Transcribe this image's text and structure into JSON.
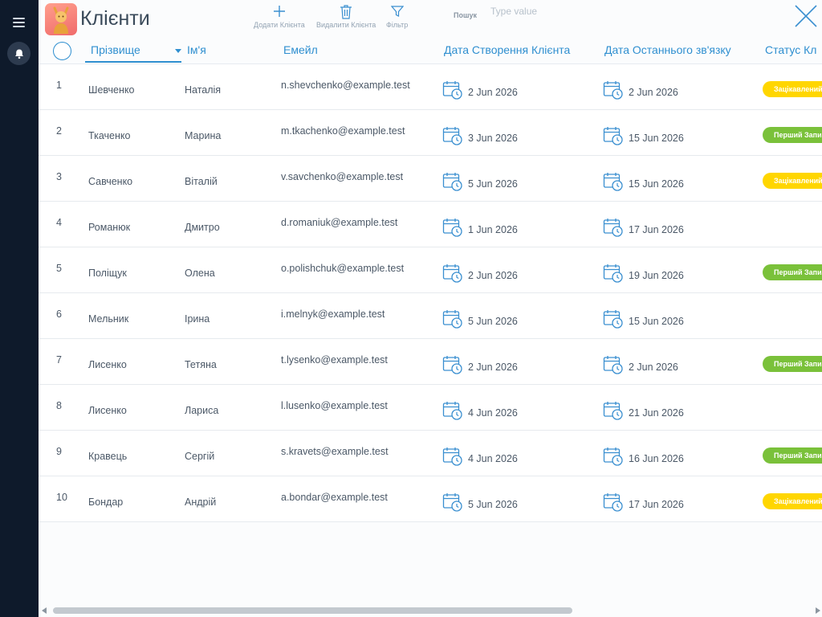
{
  "header": {
    "title": "Клієнти",
    "add_label": "Додати Клієнта",
    "delete_label": "Видалити Клієнта",
    "filter_label": "Фільтр",
    "search_label": "Пошук",
    "search_placeholder": "Type value",
    "search_value": ""
  },
  "columns": {
    "last": "Прізвище",
    "first": "Ім'я",
    "email": "Емейл",
    "created": "Дата Створення Клієнта",
    "contact": "Дата Останнього зв'язку",
    "status": "Статус Кл"
  },
  "colors": {
    "accent": "#2f8fd0",
    "status_interested": "#ffd600",
    "status_first": "#7ac13a",
    "rail": "#0e1a2b"
  },
  "status_labels": {
    "interested": "Зацікавлений",
    "first": "Перший Запис"
  },
  "rows": [
    {
      "idx": "1",
      "last": "Шевченко",
      "first": "Наталія",
      "email": "n.shevchenko@example.test",
      "created": "2 Jun 2026",
      "contact": "2 Jun 2026",
      "status": "interested"
    },
    {
      "idx": "2",
      "last": "Ткаченко",
      "first": "Марина",
      "email": "m.tkachenko@example.test",
      "created": "3 Jun 2026",
      "contact": "15 Jun 2026",
      "status": "first"
    },
    {
      "idx": "3",
      "last": "Савченко",
      "first": "Віталій",
      "email": "v.savchenko@example.test",
      "created": "5 Jun 2026",
      "contact": "15 Jun 2026",
      "status": "interested"
    },
    {
      "idx": "4",
      "last": "Романюк",
      "first": "Дмитро",
      "email": "d.romaniuk@example.test",
      "created": "1 Jun 2026",
      "contact": "17 Jun 2026",
      "status": ""
    },
    {
      "idx": "5",
      "last": "Поліщук",
      "first": "Олена",
      "email": "o.polishchuk@example.test",
      "created": "2 Jun 2026",
      "contact": "19 Jun 2026",
      "status": "first"
    },
    {
      "idx": "6",
      "last": "Мельник",
      "first": "Ірина",
      "email": "i.melnyk@example.test",
      "created": "5 Jun 2026",
      "contact": "15 Jun 2026",
      "status": ""
    },
    {
      "idx": "7",
      "last": "Лисенко",
      "first": "Тетяна",
      "email": "t.lysenko@example.test",
      "created": "2 Jun 2026",
      "contact": "2 Jun 2026",
      "status": "first"
    },
    {
      "idx": "8",
      "last": "Лисенко",
      "first": "Лариса",
      "email": "l.lusenko@example.test",
      "created": "4 Jun 2026",
      "contact": "21 Jun 2026",
      "status": ""
    },
    {
      "idx": "9",
      "last": "Кравець",
      "first": "Сергій",
      "email": "s.kravets@example.test",
      "created": "4 Jun 2026",
      "contact": "16 Jun 2026",
      "status": "first"
    },
    {
      "idx": "10",
      "last": "Бондар",
      "first": "Андрій",
      "email": "a.bondar@example.test",
      "created": "5 Jun 2026",
      "contact": "17 Jun 2026",
      "status": "interested"
    }
  ]
}
